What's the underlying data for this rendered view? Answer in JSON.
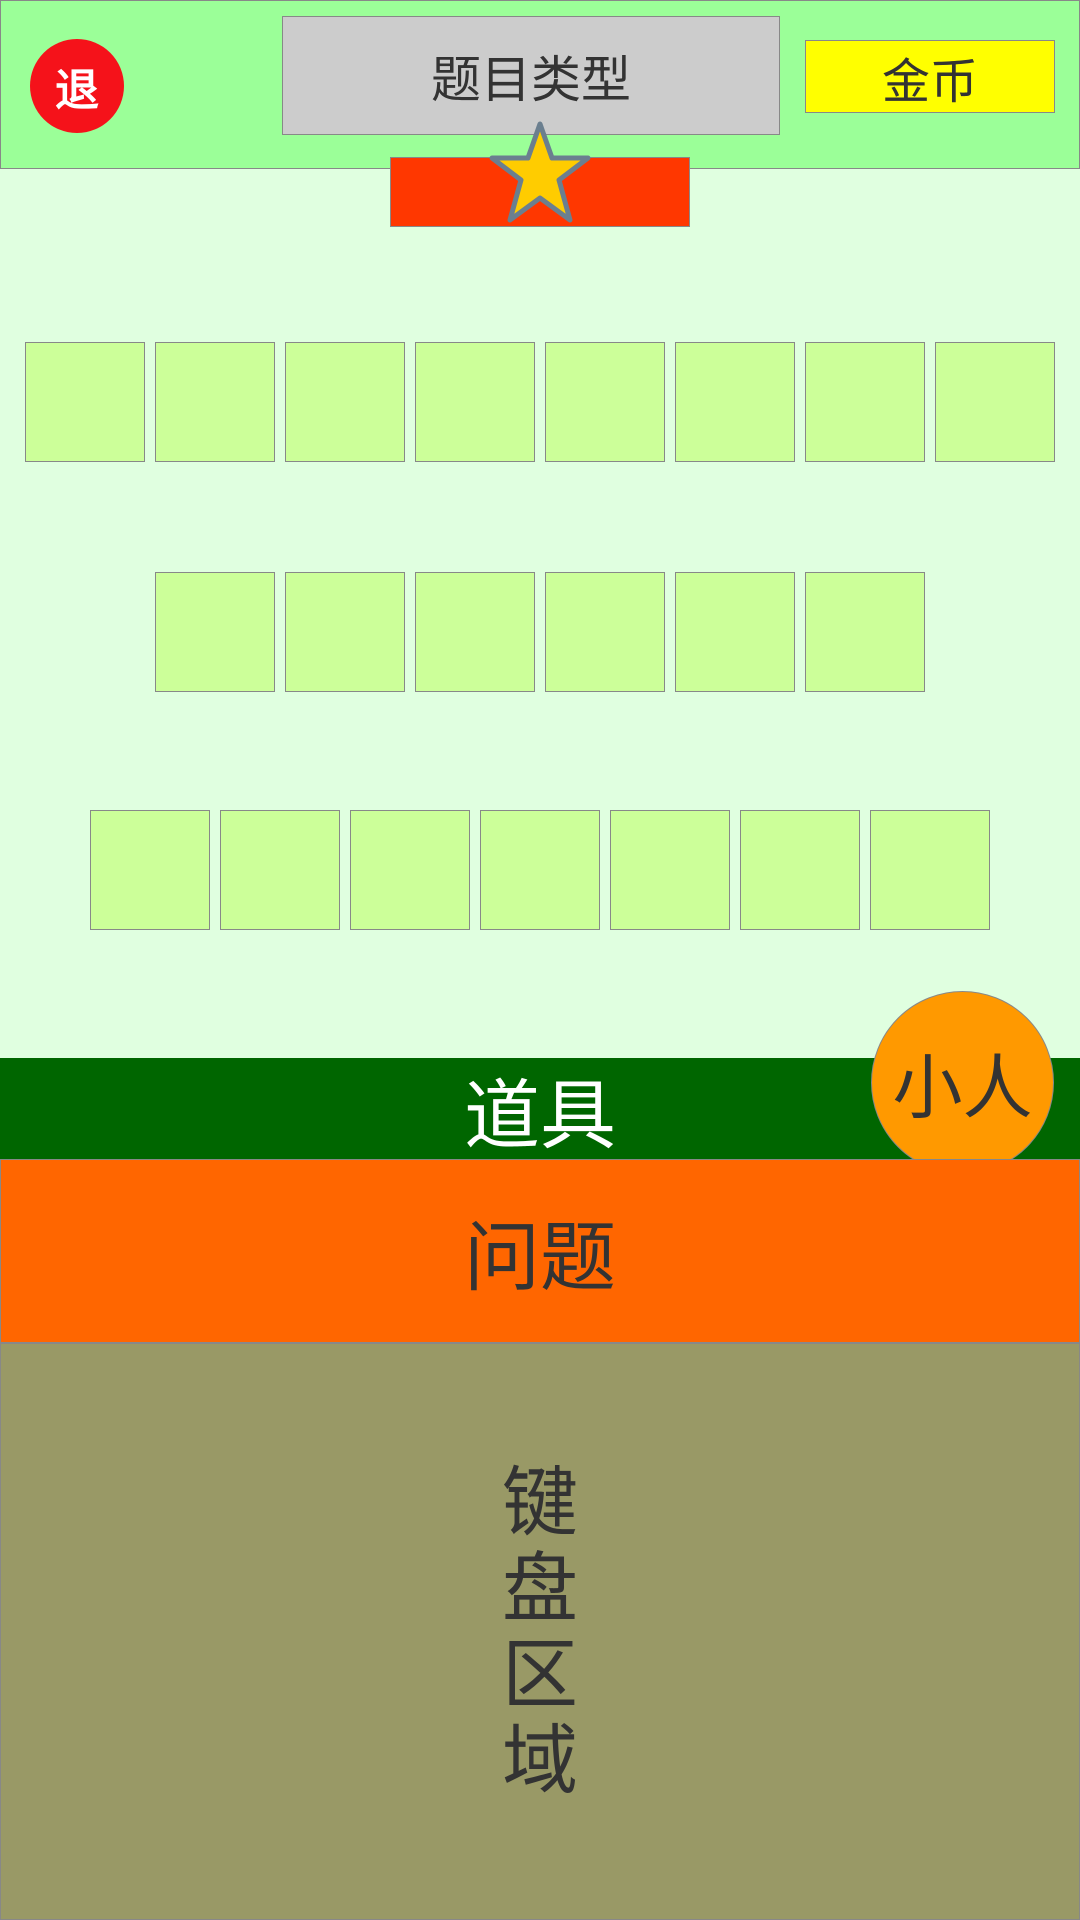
{
  "header": {
    "exit_label": "退",
    "title": "题目类型",
    "coins_label": "金币"
  },
  "colors": {
    "header_bg": "#9bff98",
    "exit_button": "#f5121a",
    "title_box": "#cccccc",
    "coins_box": "#ffff00",
    "progress_bar": "#ff3700",
    "star": "#ffcc00",
    "answer_slot": "#ccff99",
    "props_bar": "#006600",
    "character": "#ff9900",
    "question_panel": "#ff6600",
    "keyboard_area": "#999966"
  },
  "progress": {
    "icon": "star-icon"
  },
  "answer_rows": [
    {
      "slot_count": 8
    },
    {
      "slot_count": 6
    },
    {
      "slot_count": 7
    }
  ],
  "props_label": "道具",
  "character_label": "小人",
  "question_label": "问题",
  "keyboard_label": "键盘区域"
}
